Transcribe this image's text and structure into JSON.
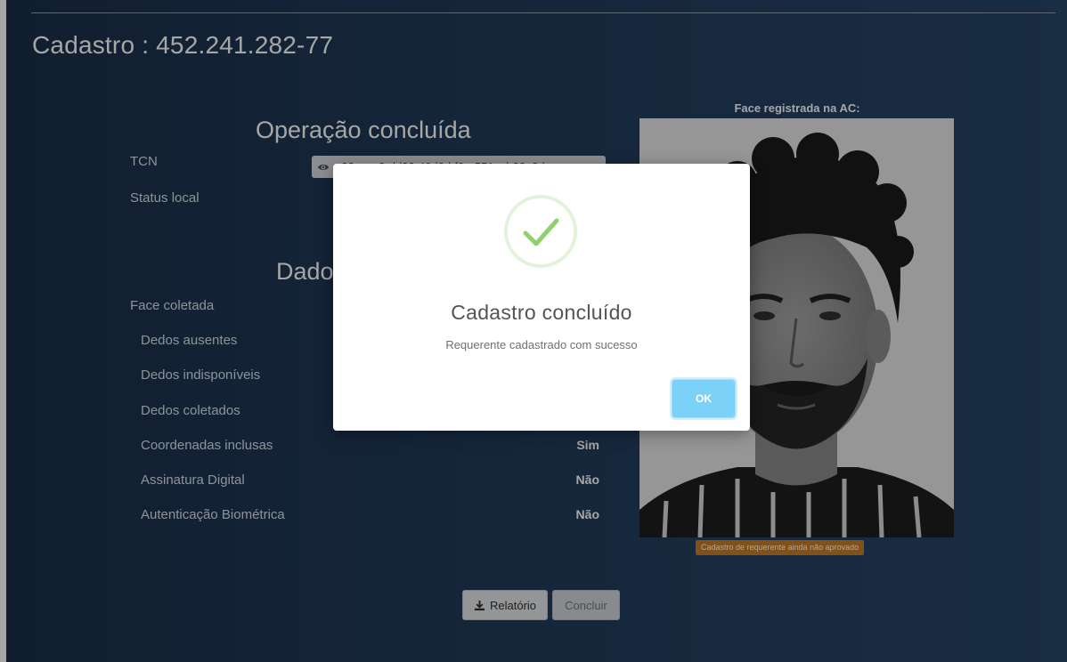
{
  "page": {
    "title": "Cadastro : 452.241.282-77"
  },
  "operation": {
    "heading": "Operação concluída",
    "tcn_label": "TCN",
    "tcn_value": "e22ecac2-dd32-40d0-bf0e-551ecb22a8de",
    "status_label": "Status local"
  },
  "dados": {
    "heading": "Dados",
    "fields": [
      {
        "label": "Face coletada",
        "value": ""
      },
      {
        "label": "Dedos ausentes",
        "value": ""
      },
      {
        "label": "Dedos indisponíveis",
        "value": ""
      },
      {
        "label": "Dedos coletados",
        "value": ""
      },
      {
        "label": "Coordenadas inclusas",
        "value": "Sim"
      },
      {
        "label": "Assinatura Digital",
        "value": "Não"
      },
      {
        "label": "Autenticação Biométrica",
        "value": "Não"
      }
    ]
  },
  "face": {
    "caption": "Face registrada na AC:",
    "status_badge": "Cadastro de requerente ainda não aprovado"
  },
  "actions": {
    "report_label": "Relatório",
    "report_icon": "download-icon",
    "finish_label": "Concluir"
  },
  "modal": {
    "icon": "success-check-icon",
    "title": "Cadastro concluído",
    "message": "Requerente cadastrado com sucesso",
    "ok_label": "OK"
  },
  "colors": {
    "background_dark": "#1a2f49",
    "background_light": "#274567",
    "ok_button": "#7cd1f9",
    "success_check": "#8fd16c",
    "warning_badge": "#c77d29"
  }
}
